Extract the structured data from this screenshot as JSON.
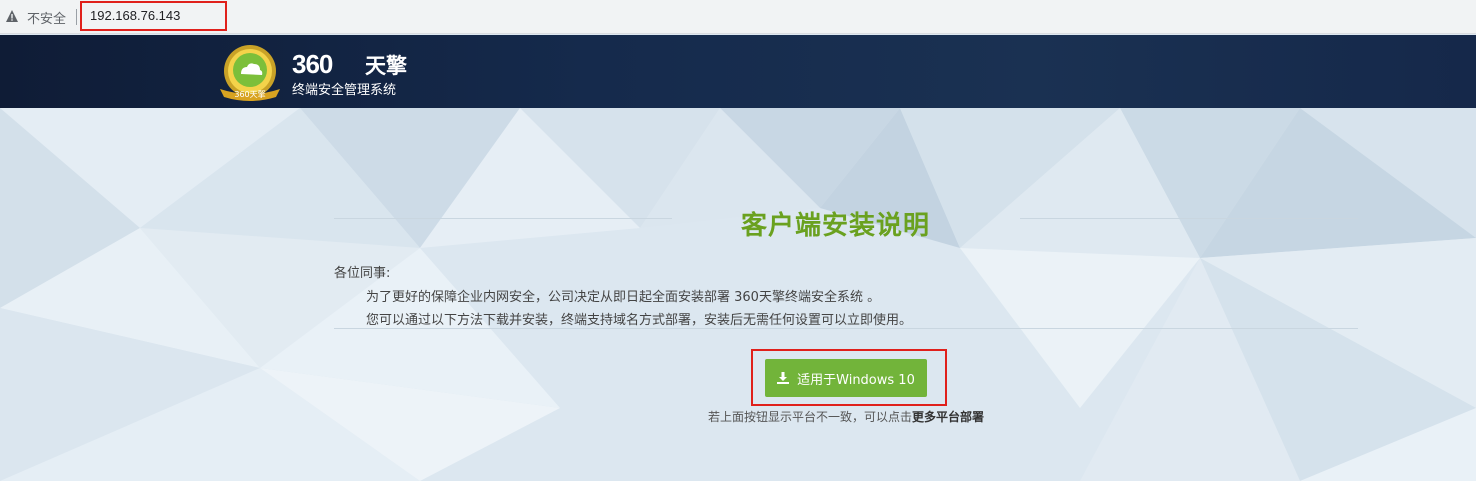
{
  "browser": {
    "security_label": "不安全",
    "url": "192.168.76.143"
  },
  "header": {
    "logo_number": "360",
    "logo_name": "天擎",
    "logo_subtitle": "终端安全管理系统",
    "badge_text": "360天擎"
  },
  "main": {
    "title": "客户端安装说明",
    "greeting": "各位同事:",
    "paragraphs": [
      "为了更好的保障企业内网安全，公司决定从即日起全面安装部署 360天擎终端安全系统 。",
      "您可以通过以下方法下载并安装，终端支持域名方式部署，安装后无需任何设置可以立即使用。"
    ],
    "download_button": "适用于Windows 10",
    "hint_text": "若上面按钮显示平台不一致，可以点击",
    "hint_link": "更多平台部署"
  },
  "colors": {
    "accent_green": "#6aa11f",
    "button_green": "#72b43a",
    "highlight_red": "#e0201b",
    "header_navy": "#152a4c"
  },
  "icons": [
    "warning-icon",
    "download-icon",
    "logo-badge-icon"
  ]
}
